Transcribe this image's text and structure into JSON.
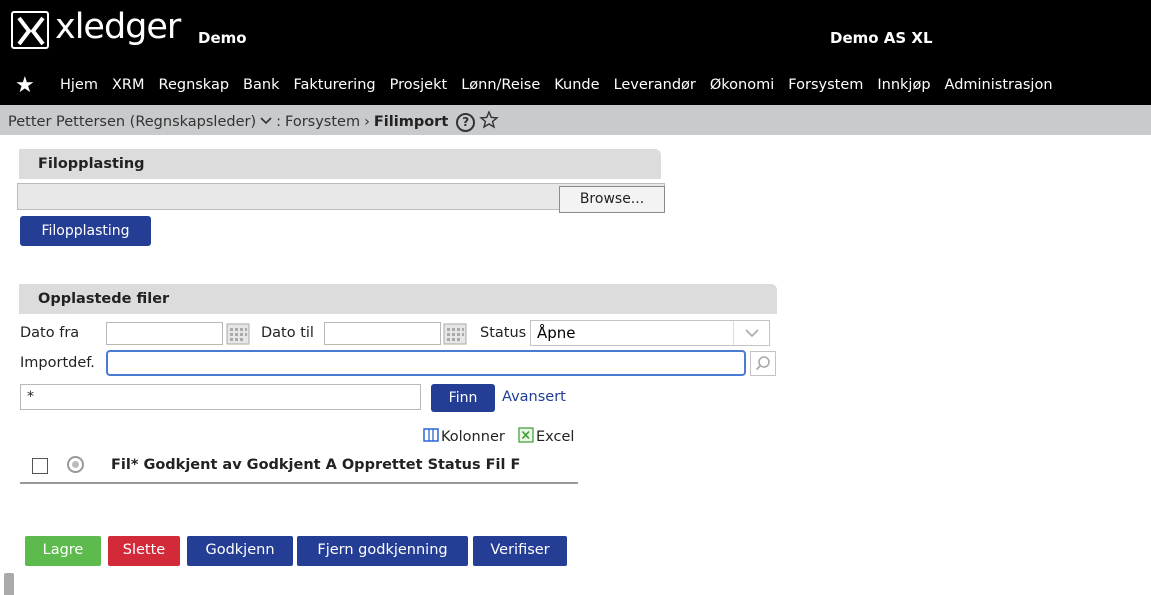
{
  "app": {
    "logo_text": "xledger",
    "company": "Demo",
    "tenant": "Demo AS XL"
  },
  "nav": {
    "items": [
      "Hjem",
      "XRM",
      "Regnskap",
      "Bank",
      "Fakturering",
      "Prosjekt",
      "Lønn/Reise",
      "Kunde",
      "Leverandør",
      "Økonomi",
      "Forsystem",
      "Innkjøp",
      "Administrasjon"
    ]
  },
  "breadcrumb": {
    "user": "Petter Pettersen (Regnskapsleder)",
    "separator": ":",
    "module": "Forsystem",
    "arrow": "›",
    "page": "Filimport",
    "help": "?"
  },
  "upload": {
    "header": "Filopplasting",
    "browse_label": "Browse...",
    "upload_button": "Filopplasting"
  },
  "files": {
    "header": "Opplastede filer",
    "date_from_label": "Dato fra",
    "date_to_label": "Dato til",
    "status_label": "Status",
    "status_value": "Åpne",
    "importdef_label": "Importdef.",
    "search_value": "*",
    "find_button": "Finn",
    "advanced_link": "Avansert",
    "columns_link": "Kolonner",
    "excel_link": "Excel",
    "table_columns": [
      "Fil*",
      "Godkjent av",
      "Godkjent",
      "A",
      "Opprettet",
      "Status",
      "Fil",
      "F"
    ]
  },
  "actions": {
    "save": "Lagre",
    "delete": "Slette",
    "approve": "Godkjenn",
    "unapprove": "Fjern godkjenning",
    "verify": "Verifiser"
  },
  "colors": {
    "primary_blue": "#253e95",
    "save_green": "#5cbb4c",
    "delete_red": "#d32a3a",
    "topbar_black": "#000000",
    "breadcrumb_gray": "#c9cacc"
  }
}
